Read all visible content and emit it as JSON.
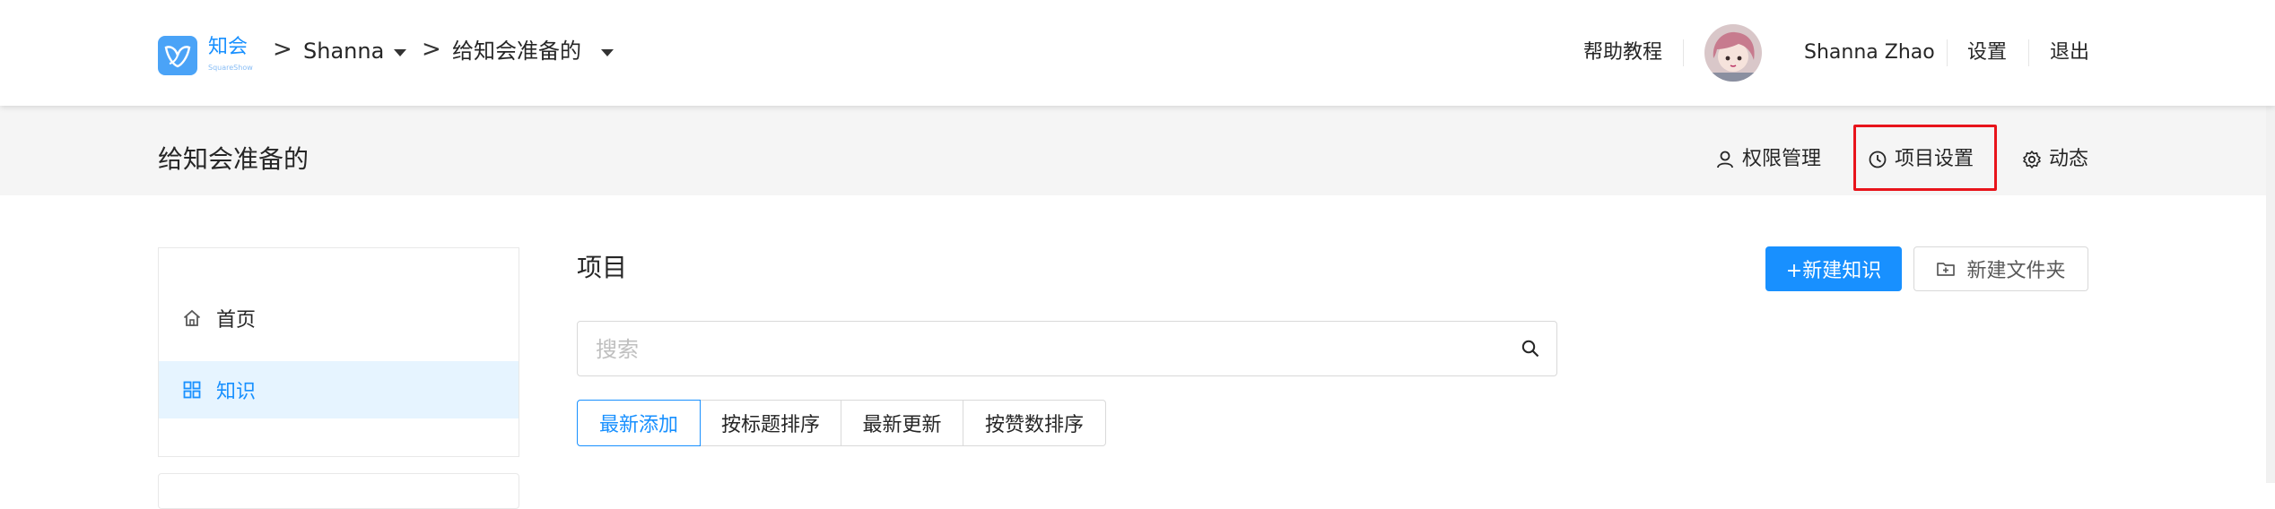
{
  "header": {
    "logo_text": "知会",
    "logo_sub": "SquareShow",
    "breadcrumb": [
      {
        "label": "Shanna"
      },
      {
        "label": "给知会准备的"
      }
    ],
    "help_label": "帮助教程",
    "user_name": "Shanna Zhao",
    "settings_label": "设置",
    "logout_label": "退出"
  },
  "subheader": {
    "project_title": "给知会准备的",
    "permissions_label": "权限管理",
    "project_settings_label": "项目设置",
    "activity_label": "动态"
  },
  "sidebar": {
    "items": [
      {
        "label": "首页",
        "icon": "home-icon",
        "active": false
      },
      {
        "label": "知识",
        "icon": "grid-icon",
        "active": true
      }
    ]
  },
  "main": {
    "title": "项目",
    "new_knowledge_label": "+新建知识",
    "new_folder_label": "新建文件夹",
    "search_placeholder": "搜索",
    "sort_tabs": [
      {
        "label": "最新添加",
        "active": true
      },
      {
        "label": "按标题排序",
        "active": false
      },
      {
        "label": "最新更新",
        "active": false
      },
      {
        "label": "按赞数排序",
        "active": false
      }
    ]
  },
  "colors": {
    "primary": "#1890ff",
    "highlight": "#e8141b",
    "subheader_bg": "#f5f5f5",
    "active_bg": "#e6f4ff"
  }
}
